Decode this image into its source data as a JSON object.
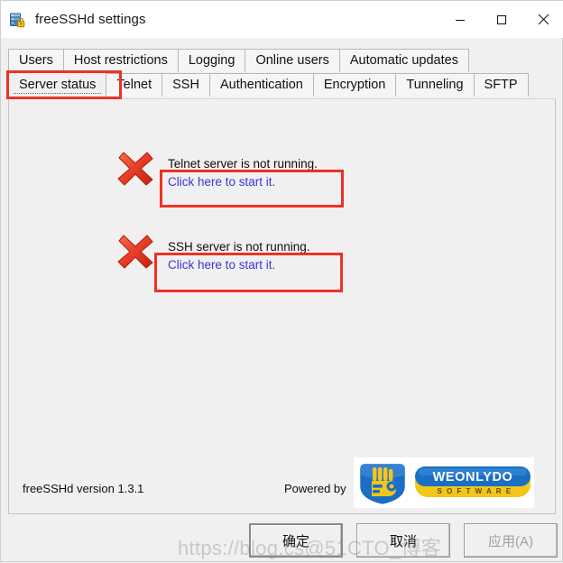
{
  "window": {
    "title": "freeSSHd settings",
    "icon": "server-lock-icon",
    "controls": {
      "minimize": "minimize-icon",
      "maximize": "maximize-icon",
      "close": "close-icon"
    }
  },
  "tabs": {
    "row1": [
      {
        "label": "Users",
        "selected": false
      },
      {
        "label": "Host restrictions",
        "selected": false
      },
      {
        "label": "Logging",
        "selected": false
      },
      {
        "label": "Online users",
        "selected": false
      },
      {
        "label": "Automatic updates",
        "selected": false
      }
    ],
    "row2": [
      {
        "label": "Server status",
        "selected": true
      },
      {
        "label": "Telnet",
        "selected": false
      },
      {
        "label": "SSH",
        "selected": false
      },
      {
        "label": "Authentication",
        "selected": false
      },
      {
        "label": "Encryption",
        "selected": false
      },
      {
        "label": "Tunneling",
        "selected": false
      },
      {
        "label": "SFTP",
        "selected": false
      }
    ]
  },
  "status": {
    "telnet": {
      "icon": "red-x-icon",
      "message": "Telnet server is not running.",
      "link": "Click here to start it."
    },
    "ssh": {
      "icon": "red-x-icon",
      "message": "SSH server is not running.",
      "link": "Click here to start it."
    }
  },
  "footer": {
    "version": "freeSSHd version 1.3.1",
    "powered_by": "Powered by",
    "logo": {
      "name": "WEONLYDO",
      "tagline": "S O F T W A R E",
      "icon": "weonlydo-shield-icon"
    }
  },
  "buttons": {
    "ok": "确定",
    "cancel": "取消",
    "apply": "应用(A)"
  },
  "watermark": "https://blog.cs@51CTO_博客",
  "colors": {
    "annotation_red": "#ee3124",
    "link_blue": "#3a36d8",
    "logo_blue": "#1a6fc4",
    "logo_yellow": "#f5c518",
    "window_bg": "#f0f0f0"
  }
}
